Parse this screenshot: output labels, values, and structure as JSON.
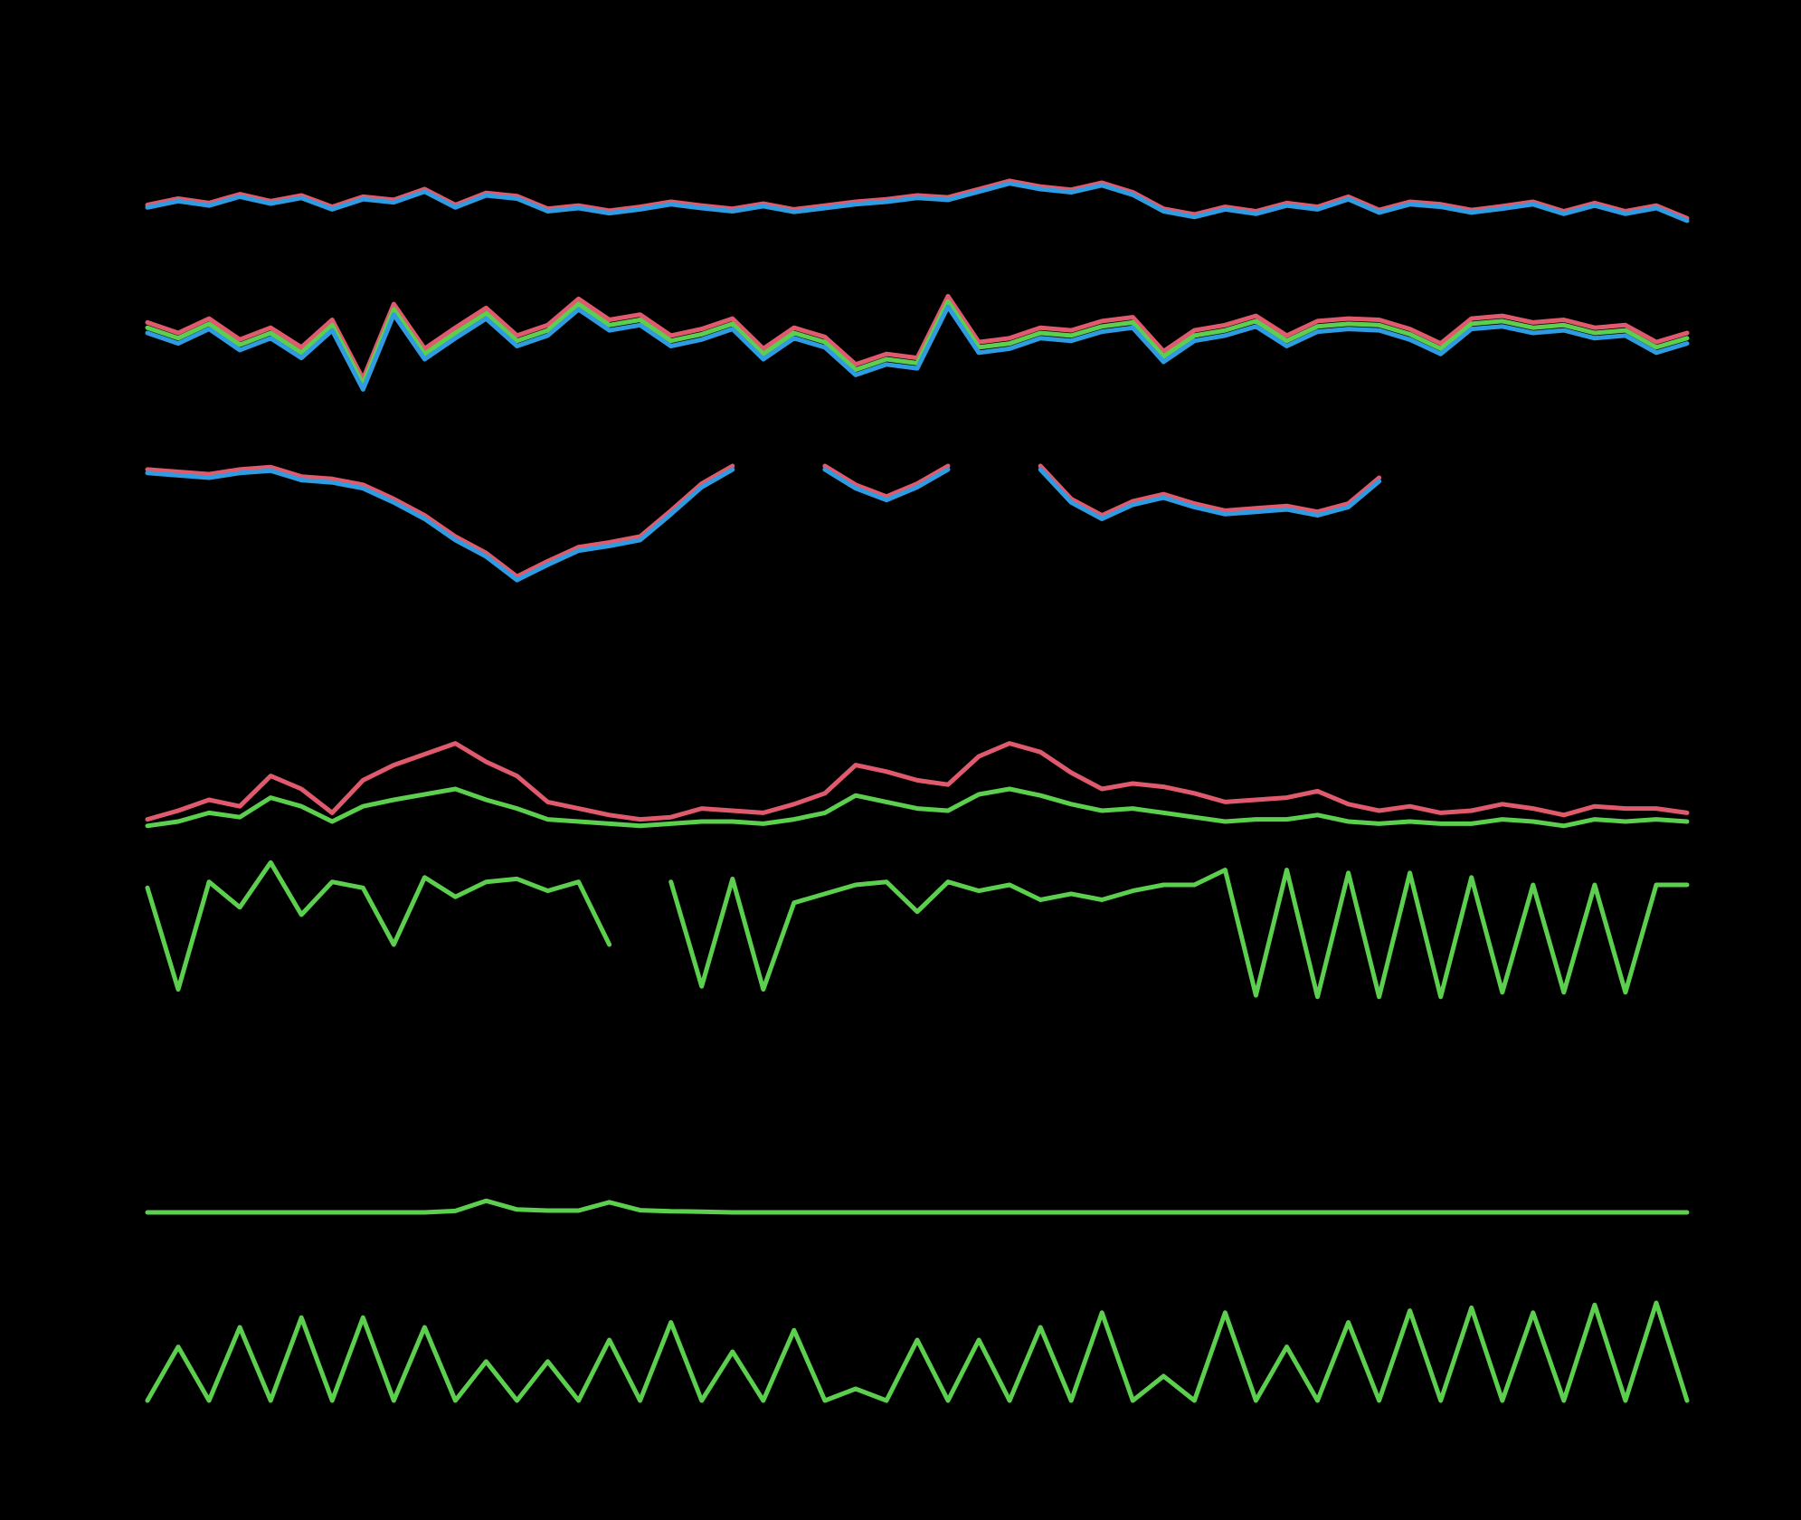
{
  "chart_data": {
    "type": "line",
    "background": "#000000",
    "colors": {
      "red": "#e05a6e",
      "blue": "#2f9be0",
      "green": "#5ccf4f"
    },
    "x": [
      0,
      2,
      4,
      6,
      8,
      10,
      12,
      14,
      16,
      18,
      20,
      22,
      24,
      26,
      28,
      30,
      32,
      34,
      36,
      38,
      40,
      42,
      44,
      46,
      48,
      50,
      52,
      54,
      56,
      58,
      60,
      62,
      64,
      66,
      68,
      70,
      72,
      74,
      76,
      78,
      80,
      82,
      84,
      86,
      88,
      90,
      92,
      94,
      96,
      98,
      100
    ],
    "panels": [
      {
        "series": [
          {
            "color": "red",
            "values": [
              0.55,
              0.65,
              0.58,
              0.72,
              0.61,
              0.7,
              0.52,
              0.68,
              0.63,
              0.8,
              0.55,
              0.74,
              0.69,
              0.49,
              0.54,
              0.46,
              0.52,
              0.6,
              0.54,
              0.49,
              0.57,
              0.48,
              0.54,
              0.6,
              0.64,
              0.7,
              0.67,
              0.8,
              0.93,
              0.84,
              0.79,
              0.9,
              0.75,
              0.49,
              0.4,
              0.52,
              0.45,
              0.58,
              0.52,
              0.68,
              0.47,
              0.6,
              0.56,
              0.47,
              0.53,
              0.6,
              0.45,
              0.58,
              0.45,
              0.54,
              0.34
            ]
          },
          {
            "color": "blue",
            "values": [
              0.51,
              0.61,
              0.54,
              0.68,
              0.57,
              0.66,
              0.48,
              0.64,
              0.59,
              0.76,
              0.51,
              0.7,
              0.65,
              0.45,
              0.5,
              0.42,
              0.48,
              0.56,
              0.5,
              0.45,
              0.53,
              0.44,
              0.5,
              0.56,
              0.6,
              0.66,
              0.63,
              0.76,
              0.89,
              0.8,
              0.75,
              0.86,
              0.71,
              0.45,
              0.36,
              0.48,
              0.41,
              0.54,
              0.48,
              0.64,
              0.43,
              0.56,
              0.52,
              0.43,
              0.49,
              0.56,
              0.41,
              0.54,
              0.41,
              0.5,
              0.3
            ]
          }
        ]
      },
      {
        "series": [
          {
            "color": "red",
            "values": [
              0.68,
              0.6,
              0.71,
              0.55,
              0.64,
              0.49,
              0.7,
              0.25,
              0.82,
              0.48,
              0.64,
              0.79,
              0.58,
              0.66,
              0.86,
              0.7,
              0.74,
              0.58,
              0.63,
              0.71,
              0.48,
              0.64,
              0.57,
              0.36,
              0.44,
              0.41,
              0.88,
              0.53,
              0.56,
              0.64,
              0.62,
              0.69,
              0.72,
              0.46,
              0.62,
              0.66,
              0.73,
              0.58,
              0.69,
              0.71,
              0.7,
              0.63,
              0.52,
              0.71,
              0.73,
              0.68,
              0.7,
              0.64,
              0.66,
              0.53,
              0.6
            ]
          },
          {
            "color": "green",
            "values": [
              0.64,
              0.56,
              0.67,
              0.51,
              0.6,
              0.45,
              0.66,
              0.21,
              0.78,
              0.44,
              0.6,
              0.75,
              0.54,
              0.62,
              0.82,
              0.66,
              0.7,
              0.54,
              0.59,
              0.67,
              0.44,
              0.6,
              0.53,
              0.32,
              0.4,
              0.37,
              0.84,
              0.49,
              0.52,
              0.6,
              0.58,
              0.65,
              0.68,
              0.42,
              0.58,
              0.62,
              0.69,
              0.54,
              0.65,
              0.67,
              0.66,
              0.59,
              0.48,
              0.67,
              0.69,
              0.64,
              0.66,
              0.6,
              0.62,
              0.49,
              0.56
            ]
          },
          {
            "color": "blue",
            "values": [
              0.6,
              0.52,
              0.63,
              0.47,
              0.56,
              0.41,
              0.62,
              0.17,
              0.74,
              0.4,
              0.56,
              0.71,
              0.5,
              0.58,
              0.78,
              0.62,
              0.66,
              0.5,
              0.55,
              0.63,
              0.4,
              0.56,
              0.49,
              0.28,
              0.36,
              0.33,
              0.8,
              0.45,
              0.48,
              0.56,
              0.54,
              0.61,
              0.64,
              0.38,
              0.54,
              0.58,
              0.65,
              0.5,
              0.61,
              0.63,
              0.62,
              0.55,
              0.44,
              0.63,
              0.65,
              0.6,
              0.62,
              0.56,
              0.58,
              0.45,
              0.52
            ]
          }
        ]
      },
      {
        "series": [
          {
            "color": "red",
            "values": [
              0.97,
              0.95,
              0.93,
              0.97,
              0.99,
              0.91,
              0.89,
              0.84,
              0.72,
              0.58,
              0.4,
              0.26,
              0.06,
              0.19,
              0.31,
              0.35,
              0.4,
              0.62,
              0.85,
              1.0,
              null,
              null,
              1.0,
              0.84,
              0.74,
              0.85,
              1.0,
              null,
              null,
              1.0,
              0.72,
              0.58,
              0.7,
              0.76,
              0.68,
              0.62,
              0.64,
              0.66,
              0.61,
              0.68,
              0.9,
              null,
              null,
              null,
              null,
              null,
              null,
              null,
              null,
              null,
              null
            ]
          },
          {
            "color": "blue",
            "values": [
              0.94,
              0.92,
              0.9,
              0.94,
              0.96,
              0.88,
              0.86,
              0.81,
              0.69,
              0.55,
              0.37,
              0.23,
              0.03,
              0.16,
              0.28,
              0.32,
              0.37,
              0.59,
              0.82,
              0.97,
              null,
              null,
              0.97,
              0.81,
              0.71,
              0.82,
              0.97,
              null,
              null,
              0.97,
              0.69,
              0.55,
              0.67,
              0.73,
              0.65,
              0.59,
              0.61,
              0.63,
              0.58,
              0.65,
              0.87,
              null,
              null,
              null,
              null,
              null,
              null,
              null,
              null,
              null,
              null
            ]
          }
        ]
      },
      {
        "series": [
          {
            "color": "red",
            "values": [
              0.12,
              0.2,
              0.3,
              0.24,
              0.52,
              0.4,
              0.18,
              0.48,
              0.62,
              0.72,
              0.82,
              0.65,
              0.52,
              0.28,
              0.22,
              0.16,
              0.12,
              0.14,
              0.22,
              0.2,
              0.18,
              0.26,
              0.36,
              0.62,
              0.56,
              0.48,
              0.44,
              0.7,
              0.82,
              0.74,
              0.55,
              0.4,
              0.45,
              0.42,
              0.36,
              0.28,
              0.3,
              0.32,
              0.38,
              0.26,
              0.2,
              0.24,
              0.18,
              0.2,
              0.26,
              0.22,
              0.16,
              0.24,
              0.22,
              0.22,
              0.18
            ]
          },
          {
            "color": "green",
            "values": [
              0.06,
              0.1,
              0.18,
              0.14,
              0.32,
              0.24,
              0.1,
              0.24,
              0.3,
              0.35,
              0.4,
              0.3,
              0.22,
              0.12,
              0.1,
              0.08,
              0.06,
              0.08,
              0.1,
              0.1,
              0.08,
              0.12,
              0.18,
              0.34,
              0.28,
              0.22,
              0.2,
              0.35,
              0.4,
              0.34,
              0.26,
              0.2,
              0.22,
              0.18,
              0.14,
              0.1,
              0.12,
              0.12,
              0.16,
              0.1,
              0.08,
              0.1,
              0.08,
              0.08,
              0.12,
              0.1,
              0.06,
              0.12,
              0.1,
              0.12,
              0.1
            ]
          }
        ]
      },
      {
        "series": [
          {
            "color": "green",
            "values": [
              0.78,
              0.1,
              0.82,
              0.65,
              0.95,
              0.6,
              0.82,
              0.78,
              0.4,
              0.85,
              0.72,
              0.82,
              0.84,
              0.76,
              0.82,
              0.4,
              null,
              0.82,
              0.12,
              0.84,
              0.1,
              0.68,
              0.74,
              0.8,
              0.82,
              0.62,
              0.82,
              0.76,
              0.8,
              0.7,
              0.74,
              0.7,
              0.76,
              0.8,
              0.8,
              0.9,
              0.06,
              0.9,
              0.05,
              0.88,
              0.05,
              0.88,
              0.05,
              0.85,
              0.08,
              0.8,
              0.08,
              0.8,
              0.08,
              0.8,
              0.8
            ]
          }
        ]
      },
      {
        "series": [
          {
            "color": "green",
            "values": [
              0.0,
              0.0,
              0.0,
              0.0,
              0.0,
              0.0,
              0.0,
              0.0,
              0.0,
              0.0,
              0.04,
              0.32,
              0.08,
              0.05,
              0.05,
              0.28,
              0.06,
              0.03,
              0.02,
              0.0,
              0.0,
              0.0,
              0.0,
              0.0,
              0.0,
              0.0,
              0.0,
              0.0,
              0.0,
              0.0,
              0.0,
              0.0,
              0.0,
              0.0,
              0.0,
              0.0,
              0.0,
              0.0,
              0.0,
              0.0,
              0.0,
              0.0,
              0.0,
              0.0,
              0.0,
              0.0,
              0.0,
              0.0,
              0.0,
              0.0,
              0.0
            ]
          }
        ]
      },
      {
        "series": [
          {
            "color": "green",
            "values": [
              0.0,
              0.55,
              0.0,
              0.75,
              0.0,
              0.85,
              0.0,
              0.85,
              0.0,
              0.75,
              0.0,
              0.4,
              0.0,
              0.4,
              0.0,
              0.62,
              0.0,
              0.8,
              0.0,
              0.5,
              0.0,
              0.72,
              0.0,
              0.12,
              0.0,
              0.62,
              0.0,
              0.62,
              0.0,
              0.75,
              0.0,
              0.9,
              0.0,
              0.25,
              0.0,
              0.9,
              0.0,
              0.55,
              0.0,
              0.8,
              0.0,
              0.92,
              0.0,
              0.95,
              0.0,
              0.9,
              0.0,
              0.98,
              0.0,
              1.0,
              0.0
            ]
          }
        ]
      }
    ]
  }
}
